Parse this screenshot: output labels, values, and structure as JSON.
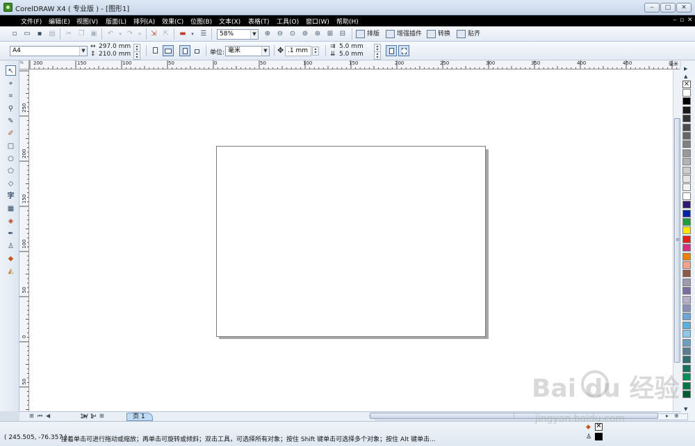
{
  "window": {
    "title": "CorelDRAW X4 ( 专业版 ) - [图形1]",
    "controls": [
      "‒",
      "□",
      "✕"
    ]
  },
  "menu": {
    "items": [
      "文件(F)",
      "编辑(E)",
      "视图(V)",
      "版面(L)",
      "排列(A)",
      "效果(C)",
      "位图(B)",
      "文本(X)",
      "表格(T)",
      "工具(O)",
      "窗口(W)",
      "帮助(H)"
    ],
    "mdi_controls": [
      "‒",
      "▫",
      "✕"
    ]
  },
  "standard_toolbar": {
    "zoom_value": "58%",
    "buttons": [
      "排版",
      "增强插件",
      "转换",
      "贴齐"
    ]
  },
  "property_bar": {
    "paper_size": "A4",
    "width": "297.0 mm",
    "height": "210.0 mm",
    "units_label": "单位:",
    "units_value": "毫米",
    "nudge": ".1 mm",
    "dup_x": "5.0 mm",
    "dup_y": "5.0 mm"
  },
  "ruler": {
    "unit": "毫米",
    "corner": "½",
    "h_ticks": [
      "200",
      "150",
      "100",
      "50",
      "0",
      "50",
      "100",
      "150",
      "200",
      "250",
      "300",
      "350",
      "400",
      "450"
    ],
    "v_ticks": [
      "250",
      "200",
      "150",
      "100",
      "50",
      "0",
      "50"
    ]
  },
  "navigator": {
    "page_count": "1 / 1",
    "page_tab": "页 1"
  },
  "status": {
    "coords": "( 245.505, -76.357 )",
    "hint": "接着单击可进行拖动或缩放；再单击可旋转或倾斜；双击工具，可选择所有对象；按住 Shift 键单击可选择多个对象；按住 Alt 键单击..."
  },
  "watermark": {
    "text": "Bai du 经验",
    "sub": "jingyan.baidu.com"
  },
  "palette_colors": [
    "#ffffff",
    "#000000",
    "#1a1a1a",
    "#333333",
    "#4d4d4d",
    "#666666",
    "#808080",
    "#999999",
    "#b3b3b3",
    "#cccccc",
    "#e6e6e6",
    "#f2f2f2",
    "#ffffff",
    "#2e1a75",
    "#0024a8",
    "#1e9f3c",
    "#ffe600",
    "#e51e1e",
    "#d6307c",
    "#f08000",
    "#f5a08c",
    "#8c5a46",
    "#9e9aaf",
    "#7a6da0",
    "#b6b0cb",
    "#8a90b8",
    "#6fa4d4",
    "#5ab1e0",
    "#8cc8ea",
    "#6ea0be",
    "#5b7c8f",
    "#2d6e6e",
    "#14735a",
    "#00915a",
    "#007846",
    "#005a32"
  ]
}
